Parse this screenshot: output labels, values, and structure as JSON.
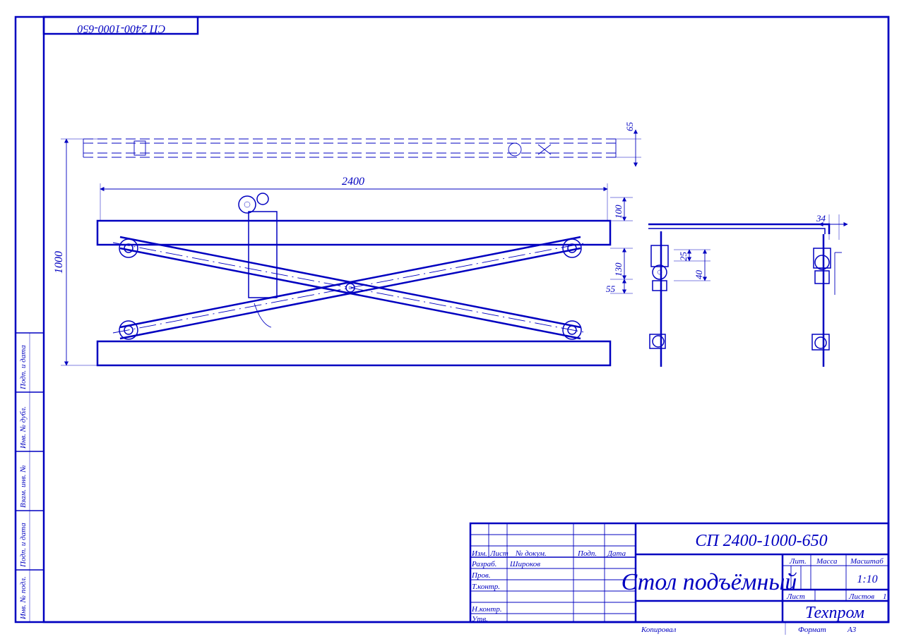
{
  "sheet": {
    "designation": "СП 2400-1000-650",
    "designation_mirrored": "СП 2400-1000-650",
    "title": "Стол подъёмный",
    "company": "Техпром",
    "bottom_copied": "Копировал",
    "bottom_format_lbl": "Формат",
    "bottom_format_val": "А3"
  },
  "titleblock": {
    "head": {
      "izm": "Изм.",
      "list": "Лист",
      "docnum": "№ докум.",
      "podp": "Подп.",
      "data": "Дата"
    },
    "rows": {
      "razrab": "Разраб.",
      "razrab_name": "Широков",
      "prov": "Пров.",
      "tkontr": "Т.контр.",
      "nkontr": "Н.контр.",
      "utv": "Утв."
    },
    "right": {
      "lit": "Лит.",
      "massa": "Масса",
      "mashtab": "Масштаб",
      "scale": "1:10",
      "list_lbl": "Лист",
      "listov_lbl": "Листов",
      "listov_val": "1"
    }
  },
  "sidebar": {
    "inv_podl": "Инв. № подл.",
    "podp_data1": "Подп. и дата",
    "vzam": "Взам. инв. №",
    "inv_dubl": "Инв. № дубл.",
    "podp_data2": "Подп. и дата"
  },
  "dims": {
    "d2400": "2400",
    "d1000": "1000",
    "d65": "65",
    "d100": "100",
    "d130": "130",
    "d55": "55",
    "d25": "25",
    "d40": "40",
    "d34": "34"
  }
}
